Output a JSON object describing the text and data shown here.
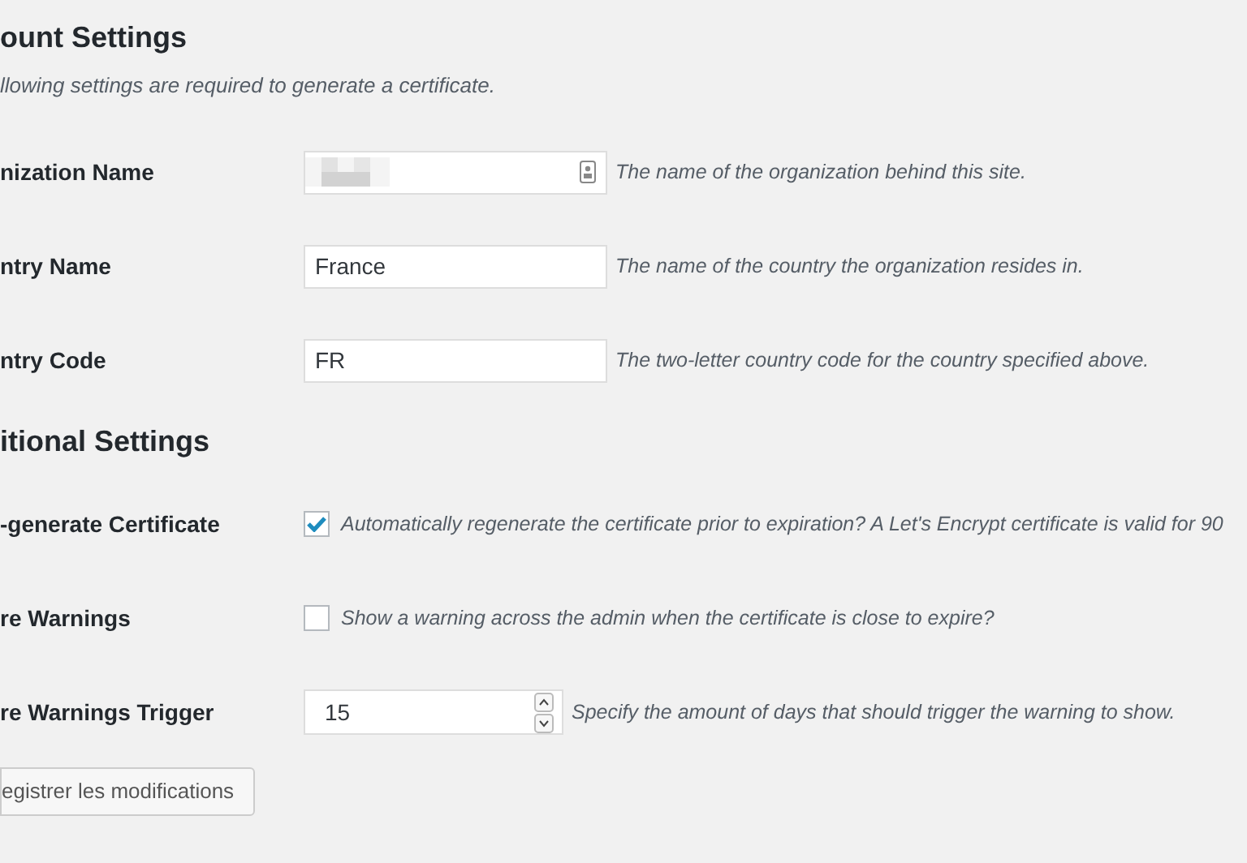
{
  "sections": [
    {
      "title": "ount Settings",
      "description": "llowing settings are required to generate a certificate.",
      "fields": [
        {
          "kind": "text",
          "label": "nization Name",
          "blurred": true,
          "description": "The name of the organization behind this site."
        },
        {
          "kind": "text",
          "label": "ntry Name",
          "value": "France",
          "description": "The name of the country the organization resides in."
        },
        {
          "kind": "text",
          "label": "ntry Code",
          "value": "FR",
          "description": "The two-letter country code for the country specified above."
        }
      ]
    },
    {
      "title": "itional Settings",
      "fields": [
        {
          "kind": "checkbox",
          "label": "-generate Certificate",
          "checked": true,
          "description": "Automatically regenerate the certificate prior to expiration? A Let's Encrypt certificate is valid for 90"
        },
        {
          "kind": "checkbox",
          "label": "re Warnings",
          "checked": false,
          "description": "Show a warning across the admin when the certificate is close to expire?"
        },
        {
          "kind": "number",
          "label": "re Warnings Trigger",
          "value": "15",
          "description": "Specify the amount of days that should trigger the warning to show."
        }
      ]
    }
  ],
  "save_button": "egistrer les modifications"
}
